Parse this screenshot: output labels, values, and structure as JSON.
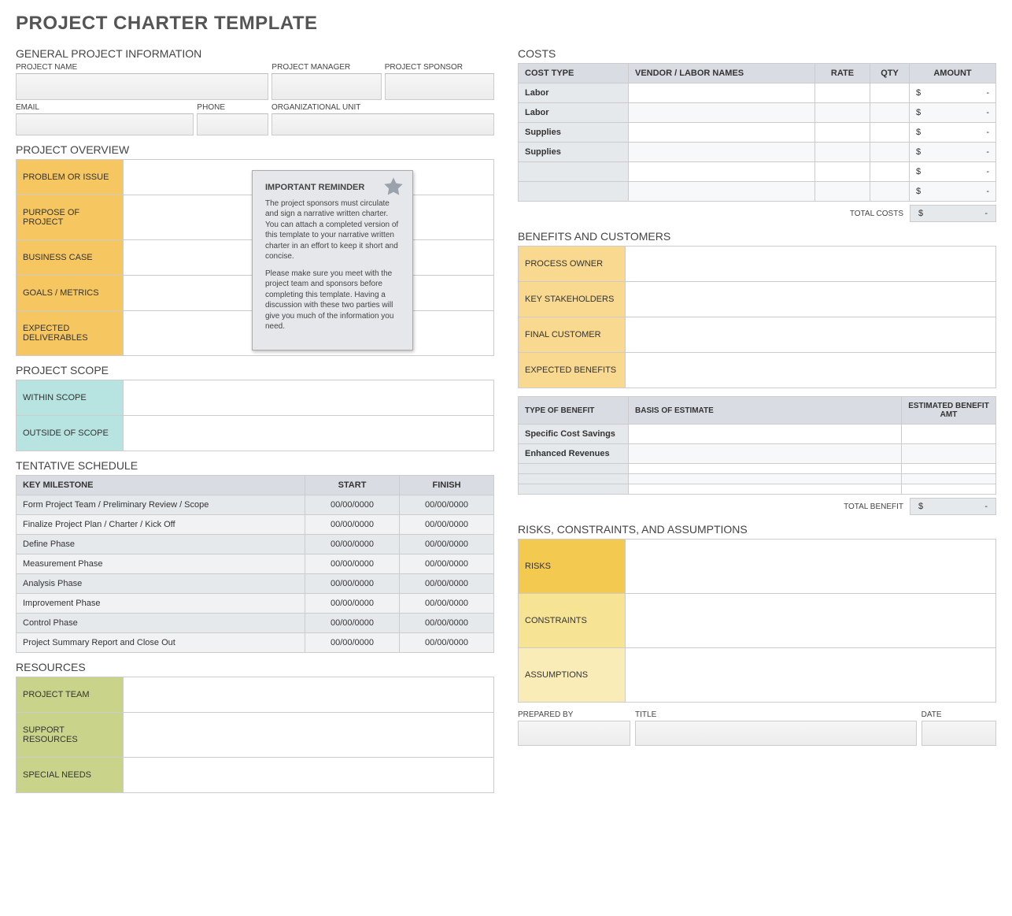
{
  "page_title": "PROJECT CHARTER TEMPLATE",
  "general": {
    "title": "GENERAL PROJECT INFORMATION",
    "labels": {
      "project_name": "PROJECT NAME",
      "project_manager": "PROJECT MANAGER",
      "project_sponsor": "PROJECT SPONSOR",
      "email": "EMAIL",
      "phone": "PHONE",
      "org_unit": "ORGANIZATIONAL UNIT"
    }
  },
  "overview": {
    "title": "PROJECT OVERVIEW",
    "rows": {
      "problem": "PROBLEM OR ISSUE",
      "purpose": "PURPOSE OF PROJECT",
      "business_case": "BUSINESS CASE",
      "goals": "GOALS / METRICS",
      "deliverables": "EXPECTED DELIVERABLES"
    },
    "callout": {
      "title": "IMPORTANT REMINDER",
      "p1": "The project sponsors must circulate and sign a narrative written charter. You can attach a completed version of this template to your narrative written charter in an effort to keep it short and concise.",
      "p2": "Please make sure you meet with the project team and sponsors before completing this template. Having a discussion with these two parties will give you much of the information you need."
    }
  },
  "scope": {
    "title": "PROJECT SCOPE",
    "within": "WITHIN SCOPE",
    "outside": "OUTSIDE OF SCOPE"
  },
  "schedule": {
    "title": "TENTATIVE SCHEDULE",
    "headers": {
      "milestone": "KEY MILESTONE",
      "start": "START",
      "finish": "FINISH"
    },
    "rows": [
      {
        "m": "Form Project Team / Preliminary Review / Scope",
        "s": "00/00/0000",
        "f": "00/00/0000"
      },
      {
        "m": "Finalize Project Plan / Charter / Kick Off",
        "s": "00/00/0000",
        "f": "00/00/0000"
      },
      {
        "m": "Define Phase",
        "s": "00/00/0000",
        "f": "00/00/0000"
      },
      {
        "m": "Measurement Phase",
        "s": "00/00/0000",
        "f": "00/00/0000"
      },
      {
        "m": "Analysis Phase",
        "s": "00/00/0000",
        "f": "00/00/0000"
      },
      {
        "m": "Improvement Phase",
        "s": "00/00/0000",
        "f": "00/00/0000"
      },
      {
        "m": "Control Phase",
        "s": "00/00/0000",
        "f": "00/00/0000"
      },
      {
        "m": "Project Summary Report and Close Out",
        "s": "00/00/0000",
        "f": "00/00/0000"
      }
    ]
  },
  "resources": {
    "title": "RESOURCES",
    "team": "PROJECT TEAM",
    "support": "SUPPORT RESOURCES",
    "special": "SPECIAL NEEDS"
  },
  "costs": {
    "title": "COSTS",
    "headers": {
      "type": "COST TYPE",
      "vendor": "VENDOR / LABOR NAMES",
      "rate": "RATE",
      "qty": "QTY",
      "amount": "AMOUNT"
    },
    "rows": [
      {
        "type": "Labor",
        "amount_sym": "$",
        "amount_val": "-"
      },
      {
        "type": "Labor",
        "amount_sym": "$",
        "amount_val": "-"
      },
      {
        "type": "Supplies",
        "amount_sym": "$",
        "amount_val": "-"
      },
      {
        "type": "Supplies",
        "amount_sym": "$",
        "amount_val": "-"
      },
      {
        "type": "",
        "amount_sym": "$",
        "amount_val": "-"
      },
      {
        "type": "",
        "amount_sym": "$",
        "amount_val": "-"
      }
    ],
    "total_label": "TOTAL COSTS",
    "total_sym": "$",
    "total_val": "-"
  },
  "benefits": {
    "title": "BENEFITS AND CUSTOMERS",
    "rows": {
      "owner": "PROCESS OWNER",
      "stakeholders": "KEY STAKEHOLDERS",
      "customer": "FINAL CUSTOMER",
      "expected": "EXPECTED BENEFITS"
    },
    "table_headers": {
      "type": "TYPE OF BENEFIT",
      "basis": "BASIS OF ESTIMATE",
      "amt": "ESTIMATED BENEFIT AMT"
    },
    "table_rows": [
      {
        "type": "Specific Cost Savings"
      },
      {
        "type": "Enhanced Revenues"
      },
      {
        "type": ""
      },
      {
        "type": ""
      },
      {
        "type": ""
      }
    ],
    "total_label": "TOTAL BENEFIT",
    "total_sym": "$",
    "total_val": "-"
  },
  "risks": {
    "title": "RISKS, CONSTRAINTS, AND ASSUMPTIONS",
    "risks": "RISKS",
    "constraints": "CONSTRAINTS",
    "assumptions": "ASSUMPTIONS"
  },
  "signoff": {
    "prepared": "PREPARED BY",
    "title": "TITLE",
    "date": "DATE"
  }
}
